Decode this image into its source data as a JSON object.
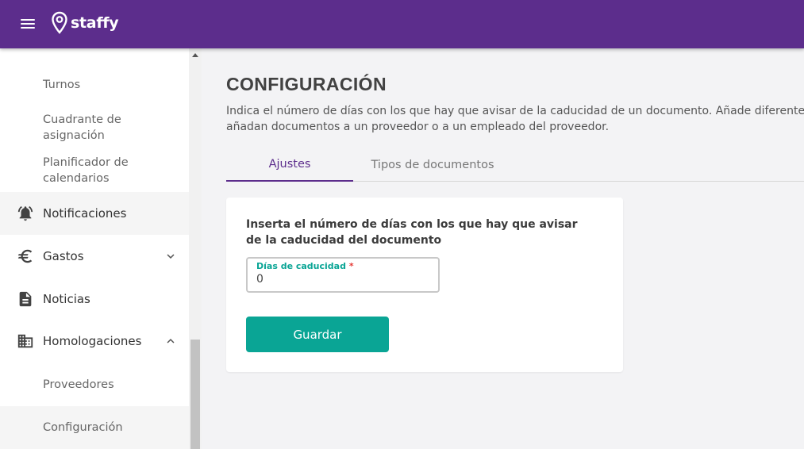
{
  "header": {
    "app_name": "staffy",
    "colors": {
      "primary": "#5c2d8c",
      "accent": "#0aa595"
    }
  },
  "sidebar": {
    "items": [
      {
        "label": "Turnos",
        "type": "sub"
      },
      {
        "label": "Cuadrante de asignación",
        "type": "sub"
      },
      {
        "label": "Planificador de calendarios",
        "type": "sub"
      },
      {
        "label": "Notificaciones",
        "icon": "bell-icon",
        "type": "main"
      },
      {
        "label": "Gastos",
        "icon": "euro-icon",
        "type": "main",
        "expand": "chevron-down-icon"
      },
      {
        "label": "Noticias",
        "icon": "document-icon",
        "type": "main"
      },
      {
        "label": "Homologaciones",
        "icon": "building-icon",
        "type": "main",
        "expand": "chevron-up-icon"
      },
      {
        "label": "Proveedores",
        "type": "sub"
      },
      {
        "label": "Configuración",
        "type": "sub",
        "selected": true
      }
    ]
  },
  "main": {
    "title": "CONFIGURACIÓN",
    "description_line1": "Indica el número de días con los que hay que avisar de la caducidad de un documento. Añade diferentes",
    "description_line2": "añadan documentos a un proveedor o a un empleado del proveedor.",
    "tabs": [
      {
        "label": "Ajustes",
        "active": true
      },
      {
        "label": "Tipos de documentos",
        "active": false
      }
    ],
    "card": {
      "instruction": "Inserta el número de días con los que hay que avisar de la caducidad del documento",
      "field_label": "Días de caducidad",
      "field_required_mark": "*",
      "field_value": "0",
      "save_label": "Guardar"
    }
  }
}
